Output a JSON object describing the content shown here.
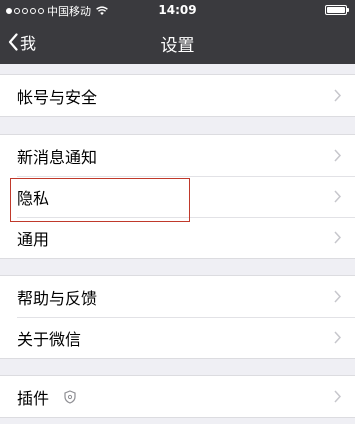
{
  "status_bar": {
    "carrier": "中国移动",
    "time": "14:09",
    "signal_filled": 1,
    "signal_total": 5,
    "battery_level": 0.95
  },
  "nav": {
    "back_label": "我",
    "title": "设置"
  },
  "groups": [
    {
      "items": [
        {
          "label": "帐号与安全"
        }
      ]
    },
    {
      "items": [
        {
          "label": "新消息通知"
        },
        {
          "label": "隐私"
        },
        {
          "label": "通用"
        }
      ]
    },
    {
      "items": [
        {
          "label": "帮助与反馈"
        },
        {
          "label": "关于微信"
        }
      ]
    },
    {
      "items": [
        {
          "label": "插件",
          "icon": "shield-icon"
        }
      ]
    }
  ],
  "colors": {
    "navbar_bg": "#3a3a3e",
    "page_bg": "#efeff4",
    "highlight_border": "#c0392b"
  }
}
